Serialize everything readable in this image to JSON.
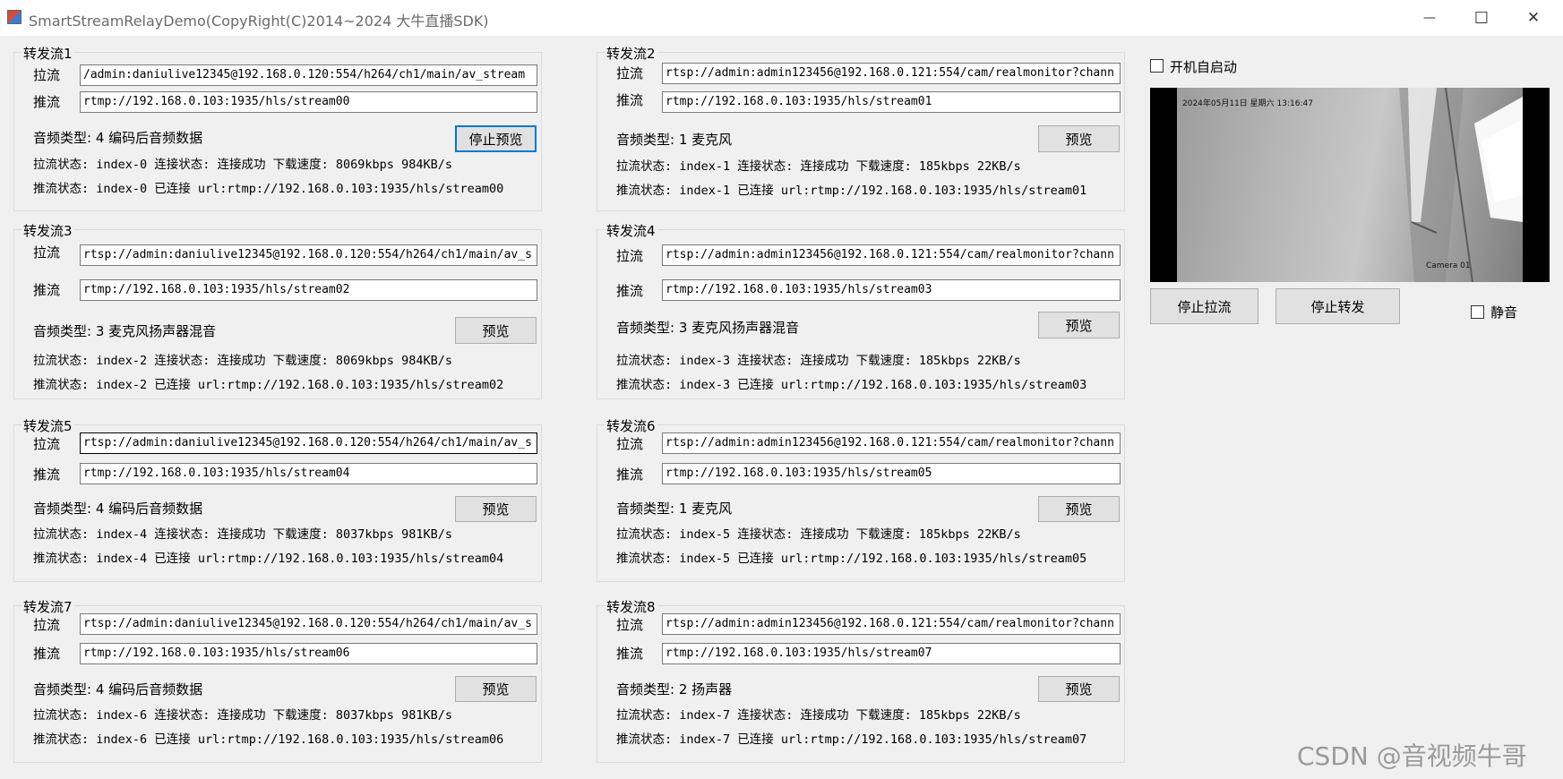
{
  "window": {
    "title": "SmartStreamRelayDemo(CopyRight(C)2014~2024 大牛直播SDK)",
    "minimize_glyph": "—",
    "maximize_glyph": "☐",
    "close_glyph": "✕"
  },
  "labels": {
    "pull": "拉流",
    "push": "推流"
  },
  "groups": [
    {
      "title": "转发流1",
      "pull_url": "/admin:daniulive12345@192.168.0.120:554/h264/ch1/main/av_stream",
      "push_url": "rtmp://192.168.0.103:1935/hls/stream00",
      "audio_type": "音频类型: 4 编码后音频数据",
      "button": "停止预览",
      "pull_status": "拉流状态: index-0 连接状态: 连接成功  下载速度: 8069kbps 984KB/s",
      "push_status": "推流状态: index-0 已连接 url:rtmp://192.168.0.103:1935/hls/stream00"
    },
    {
      "title": "转发流2",
      "pull_url": "rtsp://admin:admin123456@192.168.0.121:554/cam/realmonitor?chann",
      "push_url": "rtmp://192.168.0.103:1935/hls/stream01",
      "audio_type": "音频类型: 1 麦克风",
      "button": "预览",
      "pull_status": "拉流状态: index-1 连接状态: 连接成功  下载速度: 185kbps 22KB/s",
      "push_status": "推流状态: index-1 已连接 url:rtmp://192.168.0.103:1935/hls/stream01"
    },
    {
      "title": "转发流3",
      "pull_url": "rtsp://admin:daniulive12345@192.168.0.120:554/h264/ch1/main/av_s",
      "push_url": "rtmp://192.168.0.103:1935/hls/stream02",
      "audio_type": "音频类型: 3 麦克风扬声器混音",
      "button": "预览",
      "pull_status": "拉流状态: index-2 连接状态: 连接成功  下载速度: 8069kbps 984KB/s",
      "push_status": "推流状态: index-2 已连接 url:rtmp://192.168.0.103:1935/hls/stream02"
    },
    {
      "title": "转发流4",
      "pull_url": "rtsp://admin:admin123456@192.168.0.121:554/cam/realmonitor?chann",
      "push_url": "rtmp://192.168.0.103:1935/hls/stream03",
      "audio_type": "音频类型: 3 麦克风扬声器混音",
      "button": "预览",
      "pull_status": "拉流状态: index-3 连接状态: 连接成功  下载速度: 185kbps 22KB/s",
      "push_status": "推流状态: index-3 已连接 url:rtmp://192.168.0.103:1935/hls/stream03"
    },
    {
      "title": "转发流5",
      "pull_url": "rtsp://admin:daniulive12345@192.168.0.120:554/h264/ch1/main/av_s",
      "push_url": "rtmp://192.168.0.103:1935/hls/stream04",
      "audio_type": "音频类型: 4 编码后音频数据",
      "button": "预览",
      "pull_status": "拉流状态: index-4 连接状态: 连接成功  下载速度: 8037kbps 981KB/s",
      "push_status": "推流状态: index-4 已连接 url:rtmp://192.168.0.103:1935/hls/stream04"
    },
    {
      "title": "转发流6",
      "pull_url": "rtsp://admin:admin123456@192.168.0.121:554/cam/realmonitor?chann",
      "push_url": "rtmp://192.168.0.103:1935/hls/stream05",
      "audio_type": "音频类型: 1 麦克风",
      "button": "预览",
      "pull_status": "拉流状态: index-5 连接状态: 连接成功  下载速度: 185kbps 22KB/s",
      "push_status": "推流状态: index-5 已连接 url:rtmp://192.168.0.103:1935/hls/stream05"
    },
    {
      "title": "转发流7",
      "pull_url": "rtsp://admin:daniulive12345@192.168.0.120:554/h264/ch1/main/av_s",
      "push_url": "rtmp://192.168.0.103:1935/hls/stream06",
      "audio_type": "音频类型: 4 编码后音频数据",
      "button": "预览",
      "pull_status": "拉流状态: index-6 连接状态: 连接成功  下载速度: 8037kbps 981KB/s",
      "push_status": "推流状态: index-6 已连接 url:rtmp://192.168.0.103:1935/hls/stream06"
    },
    {
      "title": "转发流8",
      "pull_url": "rtsp://admin:admin123456@192.168.0.121:554/cam/realmonitor?chann",
      "push_url": "rtmp://192.168.0.103:1935/hls/stream07",
      "audio_type": "音频类型: 2 扬声器",
      "button": "预览",
      "pull_status": "拉流状态: index-7 连接状态: 连接成功  下载速度: 185kbps 22KB/s",
      "push_status": "推流状态: index-7 已连接 url:rtmp://192.168.0.103:1935/hls/stream07"
    }
  ],
  "right_panel": {
    "autostart_label": "开机自启动",
    "stop_pull_button": "停止拉流",
    "stop_relay_button": "停止转发",
    "mute_label": "静音",
    "preview_osd_datetime": "2024年05月11日 星期六 13:16:47",
    "preview_osd_camera": "Camera 01"
  },
  "watermark": "CSDN @音视频牛哥"
}
